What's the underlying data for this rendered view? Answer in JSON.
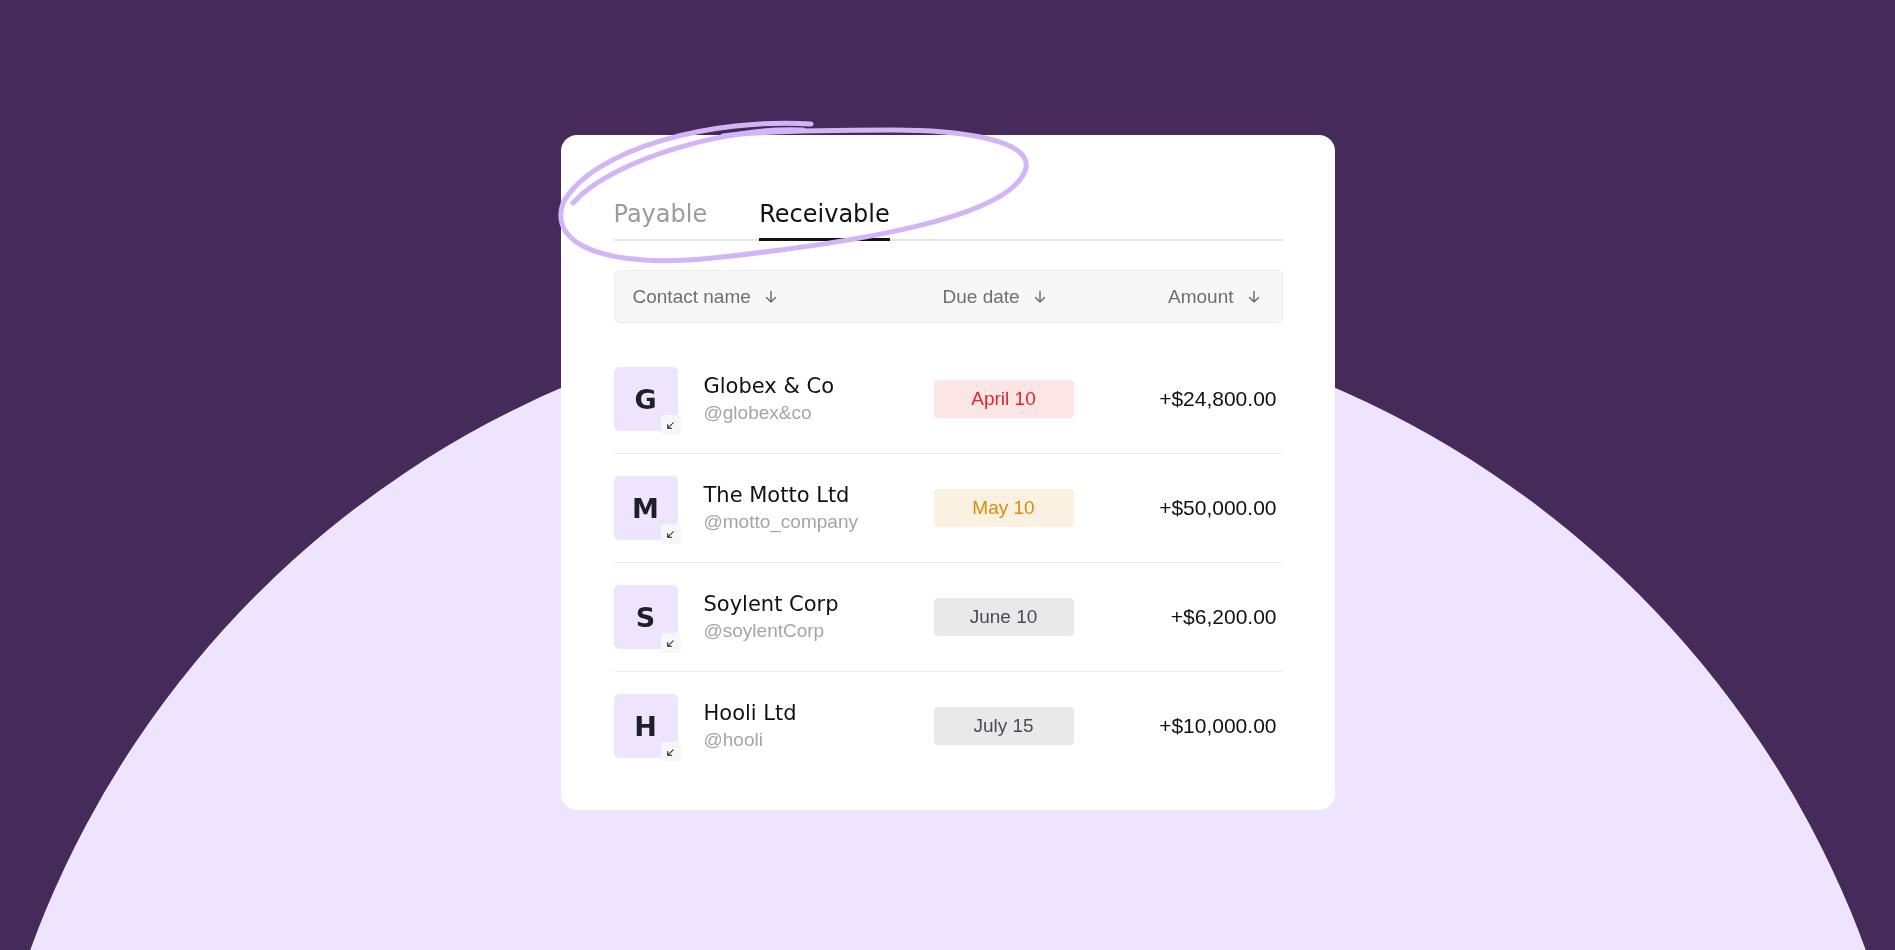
{
  "tabs": [
    {
      "label": "Payable",
      "selected": false
    },
    {
      "label": "Receivable",
      "selected": true
    }
  ],
  "table": {
    "columns": [
      {
        "label": "Contact name"
      },
      {
        "label": "Due date"
      },
      {
        "label": "Amount"
      }
    ],
    "rows": [
      {
        "initial": "G",
        "name": "Globex & Co",
        "handle": "@globex&co",
        "due": "April 10",
        "color": "#e2262a",
        "amount": "+$24,800.00"
      },
      {
        "initial": "M",
        "name": "The Motto Ltd",
        "handle": "@motto_company",
        "due": "May 10",
        "color": "#d88d0c",
        "amount": "+$50,000.00"
      },
      {
        "initial": "S",
        "name": "Soylent Corp",
        "handle": "@soylentCorp",
        "due": "June 10",
        "color": "#4b4a55",
        "amount": "+$6,200.00"
      },
      {
        "initial": "H",
        "name": "Hooli Ltd",
        "handle": "@hooli",
        "due": "July 15",
        "color": "#4b4a55",
        "amount": "+$10,000.00"
      }
    ]
  }
}
